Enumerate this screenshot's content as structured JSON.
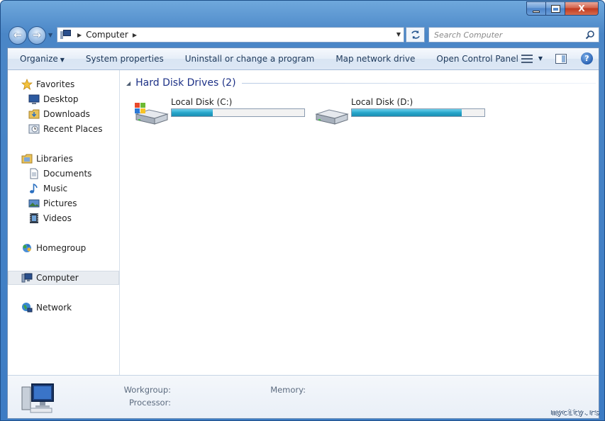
{
  "window": {
    "minimize_glyph": "",
    "maximize_glyph": "",
    "close_glyph": "X"
  },
  "nav": {
    "back_glyph": "←",
    "forward_glyph": "→",
    "breadcrumb": [
      "Computer"
    ],
    "search_placeholder": "Search Computer"
  },
  "toolbar": {
    "items": [
      {
        "label": "Organize",
        "dropdown": true
      },
      {
        "label": "System properties"
      },
      {
        "label": "Uninstall or change a program"
      },
      {
        "label": "Map network drive"
      },
      {
        "label": "Open Control Panel"
      }
    ],
    "help_glyph": "?"
  },
  "sidebar": {
    "items": [
      {
        "label": "Favorites",
        "icon": "star-icon",
        "group": "header"
      },
      {
        "label": "Desktop",
        "icon": "desktop-icon",
        "group": "child"
      },
      {
        "label": "Downloads",
        "icon": "downloads-icon",
        "group": "child"
      },
      {
        "label": "Recent Places",
        "icon": "recent-places-icon",
        "group": "child"
      },
      {
        "label": "Libraries",
        "icon": "libraries-icon",
        "group": "header"
      },
      {
        "label": "Documents",
        "icon": "documents-icon",
        "group": "child"
      },
      {
        "label": "Music",
        "icon": "music-icon",
        "group": "child"
      },
      {
        "label": "Pictures",
        "icon": "pictures-icon",
        "group": "child"
      },
      {
        "label": "Videos",
        "icon": "videos-icon",
        "group": "child"
      },
      {
        "label": "Homegroup",
        "icon": "homegroup-icon",
        "group": "header"
      },
      {
        "label": "Computer",
        "icon": "computer-icon",
        "group": "header",
        "selected": true
      },
      {
        "label": "Network",
        "icon": "network-icon",
        "group": "header"
      }
    ]
  },
  "main": {
    "group_title": "Hard Disk Drives (2)",
    "drives": [
      {
        "label": "Local Disk (C:)",
        "used_fraction": 0.31,
        "icon": "windows-drive-icon"
      },
      {
        "label": "Local Disk (D:)",
        "used_fraction": 0.83,
        "icon": "hard-drive-icon"
      }
    ]
  },
  "details": {
    "workgroup_label": "Workgroup:",
    "memory_label": "Memory:",
    "processor_label": "Processor:"
  },
  "watermark": "mycity.rs",
  "colors": {
    "accent": "#1e3287",
    "progress": "#26a6cb",
    "frame": "#4a86c7"
  }
}
